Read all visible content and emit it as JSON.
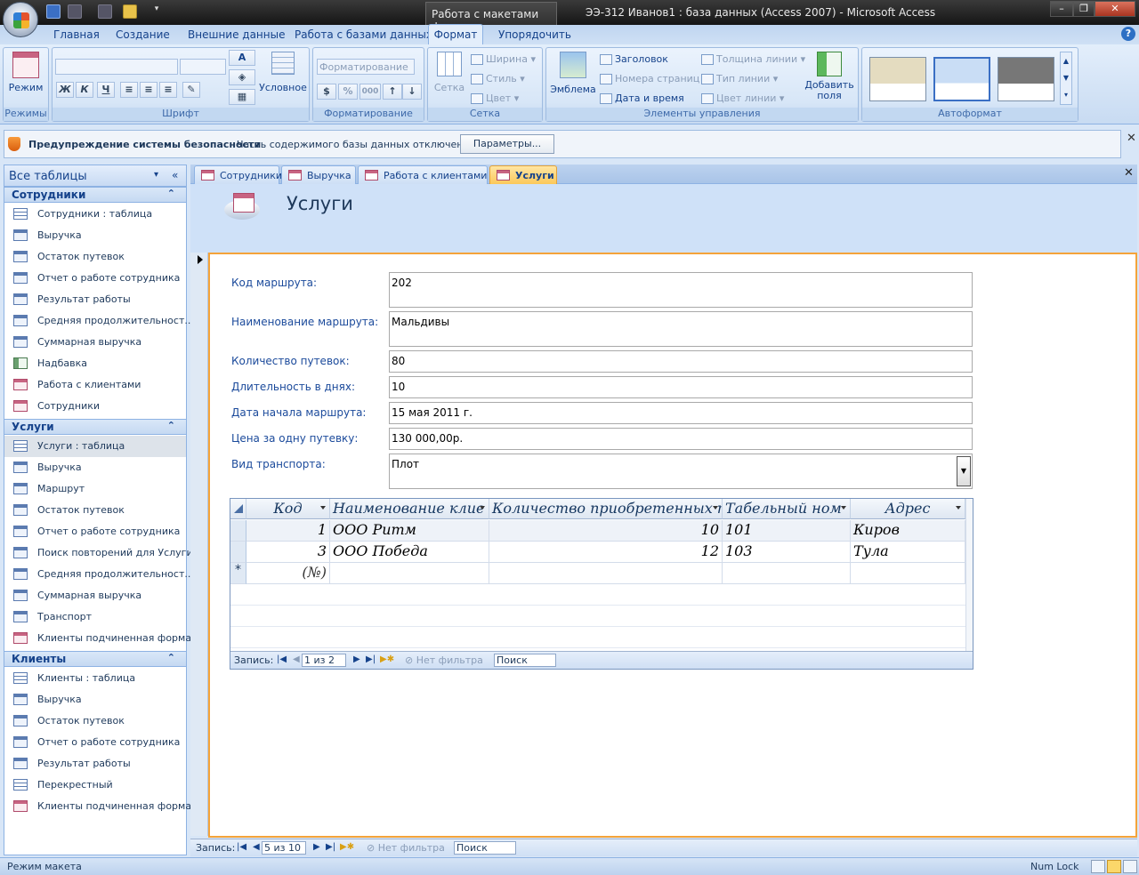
{
  "titlebar": {
    "context_tab": "Работа с макетами форм",
    "window_title": "ЭЭ-312 Иванов1 : база данных (Access 2007) - Microsoft Access",
    "buttons": [
      "–",
      "❐",
      "✕"
    ]
  },
  "ribbon_tabs": [
    "Главная",
    "Создание",
    "Внешние данные",
    "Работа с базами данных",
    "Формат",
    "Упорядочить"
  ],
  "ribbon": {
    "groups": {
      "modes": {
        "title": "Режимы",
        "button": "Режим"
      },
      "font": {
        "title": "Шрифт",
        "conditional": "Условное",
        "bold": "Ж",
        "italic": "К",
        "underline": "Ч"
      },
      "formatting": {
        "title": "Форматирование",
        "combo_placeholder": "Форматирование",
        "percent": "%",
        "thousands": "000"
      },
      "grid": {
        "title": "Сетка",
        "grid_button": "Сетка",
        "width": "Ширина",
        "style": "Стиль",
        "color": "Цвет"
      },
      "controls": {
        "title": "Элементы управления",
        "emblem": "Эмблема",
        "heading": "Заголовок",
        "page_numbers": "Номера страниц",
        "datetime": "Дата и время",
        "line_width": "Толщина линии",
        "line_type": "Тип линии",
        "line_color": "Цвет линии",
        "add_fields": "Добавить поля"
      },
      "autoformat": {
        "title": "Автоформат"
      }
    }
  },
  "security": {
    "title": "Предупреждение системы безопасности",
    "message": "Часть содержимого базы данных отключено",
    "button": "Параметры..."
  },
  "nav": {
    "header": "Все таблицы",
    "sections": [
      {
        "title": "Сотрудники",
        "items": [
          {
            "label": "Сотрудники : таблица",
            "type": "table"
          },
          {
            "label": "Выручка",
            "type": "query"
          },
          {
            "label": "Остаток путевок",
            "type": "query"
          },
          {
            "label": "Отчет о работе сотрудника",
            "type": "query"
          },
          {
            "label": "Результат работы",
            "type": "query"
          },
          {
            "label": "Средняя продолжительност...",
            "type": "query"
          },
          {
            "label": "Суммарная выручка",
            "type": "query"
          },
          {
            "label": "Надбавка",
            "type": "action"
          },
          {
            "label": "Работа с клиентами",
            "type": "report"
          },
          {
            "label": "Сотрудники",
            "type": "report"
          }
        ]
      },
      {
        "title": "Услуги",
        "items": [
          {
            "label": "Услуги : таблица",
            "type": "table"
          },
          {
            "label": "Выручка",
            "type": "query"
          },
          {
            "label": "Маршрут",
            "type": "query"
          },
          {
            "label": "Остаток путевок",
            "type": "query"
          },
          {
            "label": "Отчет о работе сотрудника",
            "type": "query"
          },
          {
            "label": "Поиск повторений для Услуги",
            "type": "query"
          },
          {
            "label": "Средняя продолжительност...",
            "type": "query"
          },
          {
            "label": "Суммарная выручка",
            "type": "query"
          },
          {
            "label": "Транспорт",
            "type": "query"
          },
          {
            "label": "Клиенты подчиненная форма",
            "type": "report"
          }
        ]
      },
      {
        "title": "Клиенты",
        "items": [
          {
            "label": "Клиенты : таблица",
            "type": "table"
          },
          {
            "label": "Выручка",
            "type": "query"
          },
          {
            "label": "Остаток путевок",
            "type": "query"
          },
          {
            "label": "Отчет о работе сотрудника",
            "type": "query"
          },
          {
            "label": "Результат работы",
            "type": "query"
          },
          {
            "label": "Перекрестный",
            "type": "table"
          },
          {
            "label": "Клиенты подчиненная форма",
            "type": "report"
          }
        ]
      }
    ]
  },
  "doc_tabs": [
    "Сотрудники",
    "Выручка",
    "Работа с клиентами",
    "Услуги"
  ],
  "form": {
    "title": "Услуги",
    "fields": [
      {
        "label": "Код маршрута:",
        "value": "202"
      },
      {
        "label": "Наименование маршрута:",
        "value": "Мальдивы"
      },
      {
        "label": "Количество путевок:",
        "value": "80"
      },
      {
        "label": "Длительность в днях:",
        "value": "10"
      },
      {
        "label": "Дата начала маршрута:",
        "value": "15 мая 2011 г."
      },
      {
        "label": "Цена за одну путевку:",
        "value": "130 000,00р."
      },
      {
        "label": "Вид транспорта:",
        "value": "Плот"
      }
    ]
  },
  "subform": {
    "columns": [
      "Код",
      "Наименование клие",
      "Количество приобретенных п",
      "Табельный ном",
      "Адрес"
    ],
    "rows": [
      [
        "1",
        "ООО Ритм",
        "10",
        "101",
        "Киров"
      ],
      [
        "3",
        "ООО Победа",
        "12",
        "103",
        "Тула"
      ]
    ],
    "new_row_marker": "*",
    "new_row_code": "(№)",
    "nav": {
      "label": "Запись:",
      "position": "1 из 2",
      "filter": "Нет фильтра",
      "search": "Поиск"
    }
  },
  "main_nav": {
    "label": "Запись:",
    "position": "5 из 10",
    "filter": "Нет фильтра",
    "search": "Поиск"
  },
  "status": {
    "left": "Режим макета",
    "num_lock": "Num Lock"
  }
}
